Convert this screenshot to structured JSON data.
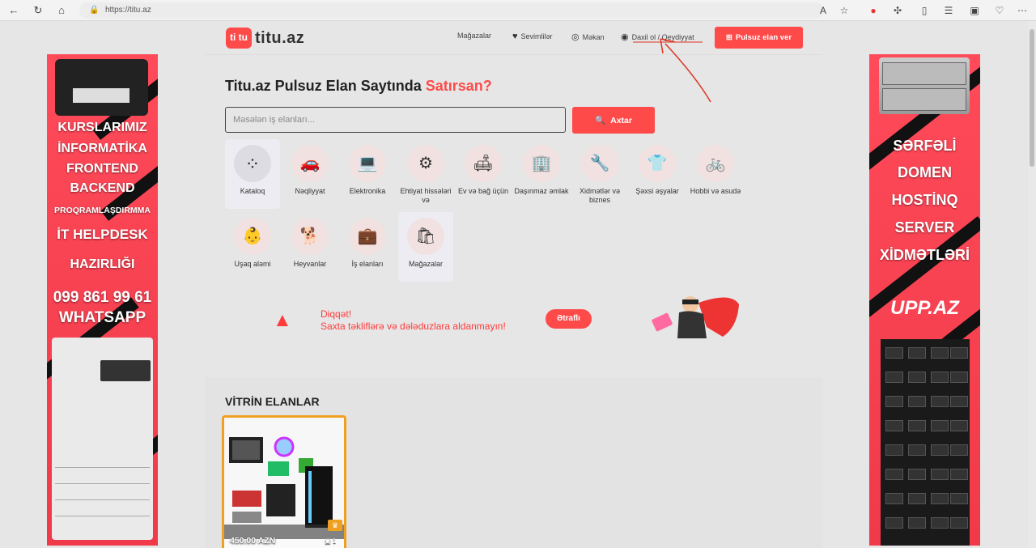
{
  "browser": {
    "url": "https://titu.az",
    "back_icon": "arrow-left-icon",
    "refresh_icon": "refresh-icon",
    "home_icon": "home-icon"
  },
  "header": {
    "logo_mark": "ti tu",
    "logo_name": "titu.az",
    "nav": [
      {
        "label": "Mağazalar",
        "icon": ""
      },
      {
        "label": "Sevimlilər",
        "icon": "heart-icon"
      },
      {
        "label": "Məkan",
        "icon": "compass-icon"
      },
      {
        "label": "Daxil ol / Qeydiyyat",
        "icon": "user-icon"
      }
    ],
    "cta_label": "Pulsuz elan ver"
  },
  "hero": {
    "title": "Titu.az Pulsuz Elan Saytında",
    "accent": "Satırsan?"
  },
  "search": {
    "placeholder": "Məsələn iş elanları...",
    "button_label": "Axtar"
  },
  "categories": [
    {
      "label": "Kataloq"
    },
    {
      "label": "Nəqliyyat"
    },
    {
      "label": "Elektronika"
    },
    {
      "label": "Ehtiyat hissələri və"
    },
    {
      "label": "Ev və bağ üçün"
    },
    {
      "label": "Daşınmaz əmlak"
    },
    {
      "label": "Xidmətlər və biznes"
    },
    {
      "label": "Şəxsi əşyalar"
    },
    {
      "label": "Hobbi və asudə"
    },
    {
      "label": "Uşaq aləmi"
    },
    {
      "label": "Heyvanlar"
    },
    {
      "label": "İş elanları"
    },
    {
      "label": "Mağazalar"
    }
  ],
  "warning": {
    "title": "Diqqət!",
    "text": "Saxta təkliflərə və dələduzlara aldanmayın!",
    "button_label": "Ətraflı"
  },
  "vitrin": {
    "heading": "VİTRİN ELANLAR",
    "cards": [
      {
        "price": "450.00 AZN",
        "photos": "1"
      }
    ]
  },
  "left_banner": {
    "lines": [
      "KURSLARIMIZ",
      "İNFORMATİKA",
      "FRONTEND",
      "BACKEND",
      "PROQRAMLAŞDIRMMA",
      "İT HELPDESK",
      "HAZIRLIĞI",
      "099 861 99 61",
      "WHATSAPP"
    ]
  },
  "right_banner": {
    "lines": [
      "SƏRFƏLİ",
      "DOMEN",
      "HOSTİNQ",
      "SERVER",
      "XİDMƏTLƏRİ"
    ],
    "brand": "UPP.AZ"
  },
  "colors": {
    "accent": "#ff4a4a",
    "warning": "#ff3b3b",
    "background": "#e6e6e6"
  }
}
